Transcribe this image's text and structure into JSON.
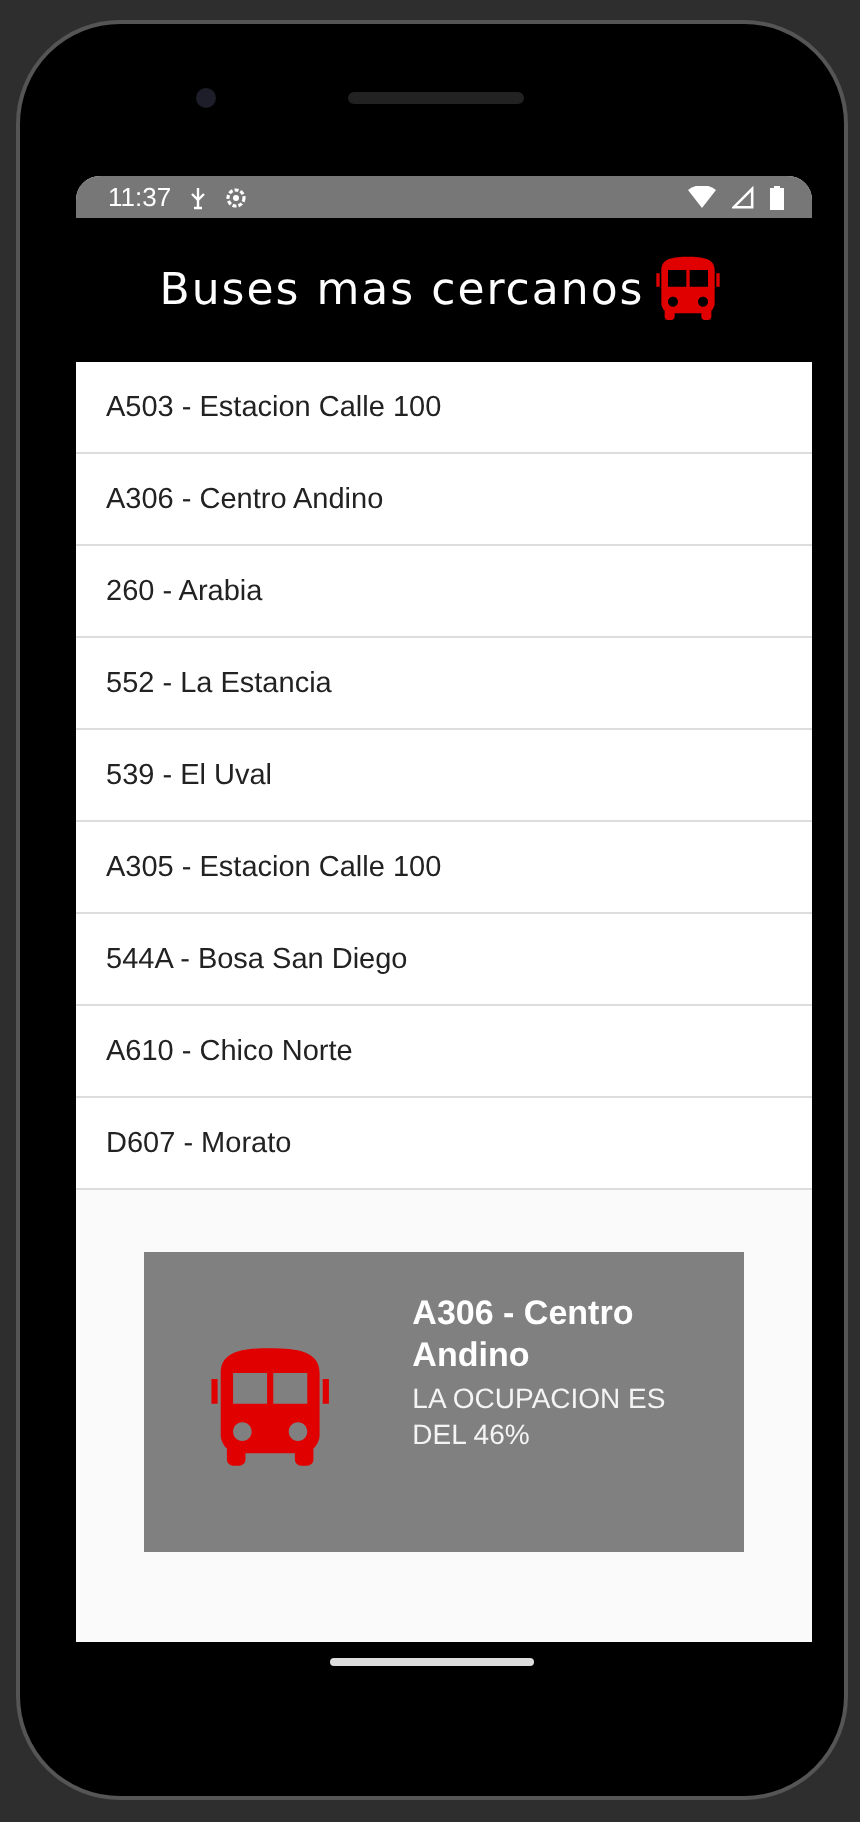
{
  "status_bar": {
    "time": "11:37"
  },
  "app_bar": {
    "title": "Buses mas cercanos"
  },
  "buses": [
    {
      "label": "A503 - Estacion Calle 100"
    },
    {
      "label": "A306 - Centro Andino"
    },
    {
      "label": "260 - Arabia"
    },
    {
      "label": "552 - La Estancia"
    },
    {
      "label": "539 - El Uval"
    },
    {
      "label": "A305 - Estacion Calle 100"
    },
    {
      "label": "544A - Bosa San Diego"
    },
    {
      "label": "A610 - Chico Norte"
    },
    {
      "label": "D607 - Morato"
    }
  ],
  "detail_card": {
    "title": "A306 - Centro Andino",
    "occupancy": "LA OCUPACION ES DEL 46%"
  }
}
